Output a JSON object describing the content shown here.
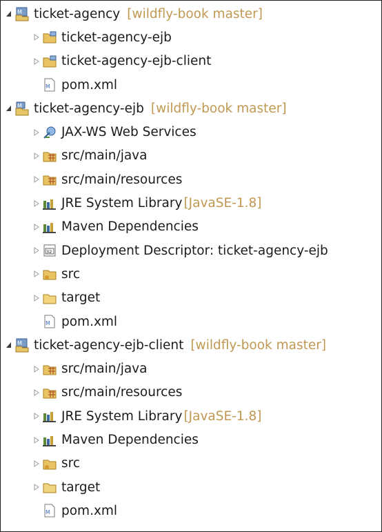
{
  "tree": {
    "rows": [
      {
        "label": "ticket-agency",
        "deco": "[wildfly-book master]",
        "icon": "maven-project-icon",
        "expanded": true,
        "level": 0
      },
      {
        "label": "ticket-agency-ejb",
        "deco": "",
        "icon": "project-folder-icon",
        "expanded": false,
        "level": 1
      },
      {
        "label": "ticket-agency-ejb-client",
        "deco": "",
        "icon": "project-folder-icon",
        "expanded": false,
        "level": 1
      },
      {
        "label": "pom.xml",
        "deco": "",
        "icon": "pom-file-icon",
        "expanded": null,
        "level": 1
      },
      {
        "label": "ticket-agency-ejb",
        "deco": "[wildfly-book master]",
        "icon": "maven-ejb-project-icon",
        "expanded": true,
        "level": 0
      },
      {
        "label": "JAX-WS Web Services",
        "deco": "",
        "icon": "web-services-icon",
        "expanded": false,
        "level": 1
      },
      {
        "label": "src/main/java",
        "deco": "",
        "icon": "source-folder-icon",
        "expanded": false,
        "level": 1
      },
      {
        "label": "src/main/resources",
        "deco": "",
        "icon": "source-folder-icon",
        "expanded": false,
        "level": 1
      },
      {
        "label": "JRE System Library",
        "deco": "[JavaSE-1.8]",
        "icon": "library-icon",
        "expanded": false,
        "level": 1
      },
      {
        "label": "Maven Dependencies",
        "deco": "",
        "icon": "library-icon",
        "expanded": false,
        "level": 1
      },
      {
        "label": "Deployment Descriptor: ticket-agency-ejb",
        "deco": "",
        "icon": "deployment-descriptor-icon",
        "expanded": false,
        "level": 1
      },
      {
        "label": "src",
        "deco": "",
        "icon": "src-folder-icon",
        "expanded": false,
        "level": 1
      },
      {
        "label": "target",
        "deco": "",
        "icon": "folder-icon",
        "expanded": false,
        "level": 1
      },
      {
        "label": "pom.xml",
        "deco": "",
        "icon": "pom-file-icon",
        "expanded": null,
        "level": 1
      },
      {
        "label": "ticket-agency-ejb-client",
        "deco": "[wildfly-book master]",
        "icon": "maven-project-icon",
        "expanded": true,
        "level": 0
      },
      {
        "label": "src/main/java",
        "deco": "",
        "icon": "source-folder-icon",
        "expanded": false,
        "level": 1
      },
      {
        "label": "src/main/resources",
        "deco": "",
        "icon": "source-folder-icon",
        "expanded": false,
        "level": 1
      },
      {
        "label": "JRE System Library",
        "deco": "[JavaSE-1.8]",
        "icon": "library-icon",
        "expanded": false,
        "level": 1
      },
      {
        "label": "Maven Dependencies",
        "deco": "",
        "icon": "library-icon",
        "expanded": false,
        "level": 1
      },
      {
        "label": "src",
        "deco": "",
        "icon": "src-folder-icon",
        "expanded": false,
        "level": 1
      },
      {
        "label": "target",
        "deco": "",
        "icon": "folder-icon",
        "expanded": false,
        "level": 1
      },
      {
        "label": "pom.xml",
        "deco": "",
        "icon": "pom-file-icon",
        "expanded": null,
        "level": 1
      }
    ]
  }
}
